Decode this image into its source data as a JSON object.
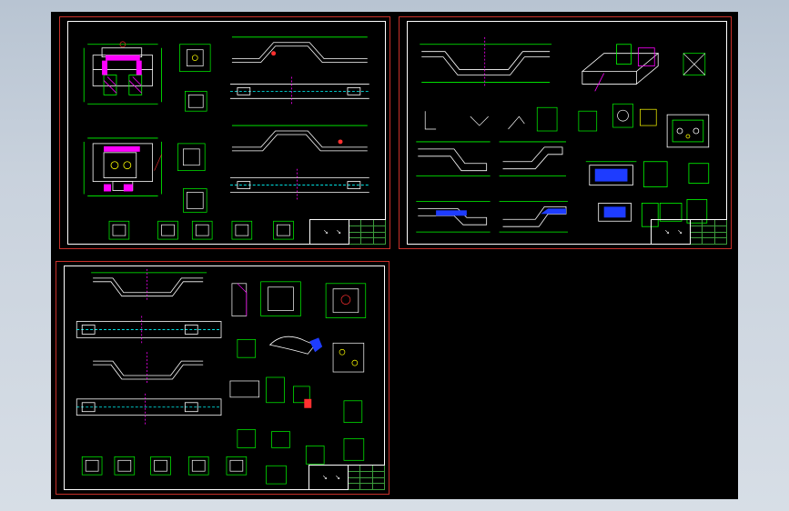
{
  "app": {
    "background": "#c9d2dd",
    "canvas_color": "#000000"
  },
  "colors": {
    "sheet_border": "#c8302a",
    "frame": "#ffffff",
    "line_main": "#ffffff",
    "line_dim": "#00ff00",
    "line_hidden": "#00ffff",
    "accent_magenta": "#ff00ff",
    "accent_yellow": "#ffff00",
    "accent_blue": "#1e3cff",
    "accent_red": "#ff3030"
  },
  "sheets": [
    {
      "name": "sheet-top-left",
      "title_block_mark": "↘ ↘"
    },
    {
      "name": "sheet-top-right",
      "title_block_mark": "↘ ↘"
    },
    {
      "name": "sheet-bottom-left",
      "title_block_mark": "↘ ↘"
    }
  ]
}
